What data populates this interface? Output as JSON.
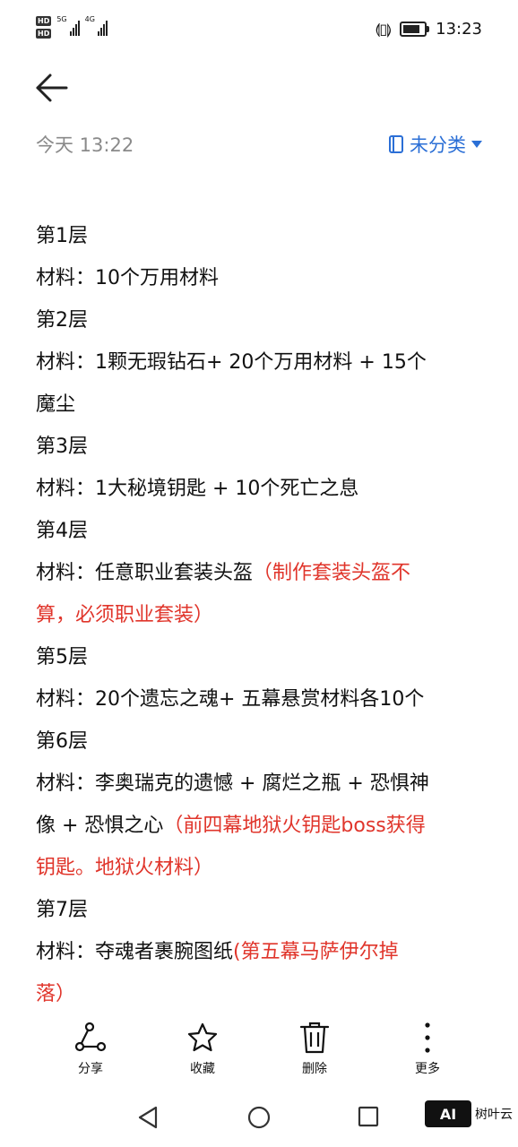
{
  "status": {
    "hd1": "HD",
    "hd2": "HD",
    "net1": "5G",
    "net2": "4G",
    "time": "13:23"
  },
  "header": {
    "back_icon": "arrow-left-icon",
    "date": "今天 13:22",
    "category": "未分类"
  },
  "note": {
    "l1": "第1层",
    "l2": "材料：10个万用材料",
    "l3": "第2层",
    "l4": "材料：1颗无瑕钻石+ 20个万用材料 + 15个",
    "l5": "魔尘",
    "l6": "第3层",
    "l7": "材料：1大秘境钥匙 + 10个死亡之息",
    "l8": "第4层",
    "l9a": "材料：任意职业套装头盔",
    "l9b": "（制作套装头盔不",
    "l10": "算，必须职业套装）",
    "l11": "第5层",
    "l12": "材料：20个遗忘之魂+ 五幕悬赏材料各10个",
    "l13": "第6层",
    "l14": "材料：李奥瑞克的遗憾 + 腐烂之瓶 + 恐惧神",
    "l15a": "像 + 恐惧之心",
    "l15b": "（前四幕地狱火钥匙boss获得",
    "l16": "钥匙。地狱火材料）",
    "l17": "第7层",
    "l18a": "材料：夺魂者裹腕图纸",
    "l18b": "(第五幕马萨伊尔掉",
    "l19": "落）"
  },
  "toolbar": {
    "share": "分享",
    "favorite": "收藏",
    "delete": "删除",
    "more": "更多"
  },
  "watermark": {
    "logo": "AI",
    "text": "树叶云"
  },
  "colors": {
    "accent": "#2b6fd6",
    "highlight": "#e0352b"
  }
}
